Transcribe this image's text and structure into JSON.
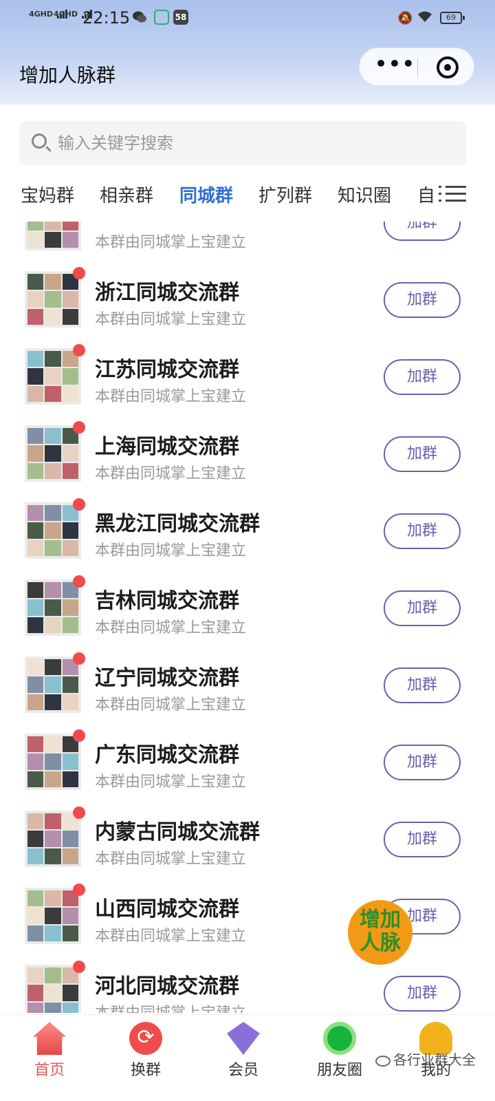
{
  "status_bar": {
    "signal1": "4GHD",
    "signal2": "4GHD",
    "time": "22:15",
    "badge_58": "58",
    "battery": "69"
  },
  "header": {
    "title": "增加人脉群",
    "more_label": "•••"
  },
  "search": {
    "placeholder": "输入关键字搜索"
  },
  "tabs": [
    {
      "label": "宝妈群"
    },
    {
      "label": "相亲群"
    },
    {
      "label": "同城群"
    },
    {
      "label": "扩列群"
    },
    {
      "label": "知识圈"
    },
    {
      "label": "自"
    }
  ],
  "active_tab": "同城群",
  "groups": [
    {
      "name": "",
      "subtitle": "本群由同城掌上宝建立",
      "button": "加群"
    },
    {
      "name": "浙江同城交流群",
      "subtitle": "本群由同城掌上宝建立",
      "button": "加群"
    },
    {
      "name": "江苏同城交流群",
      "subtitle": "本群由同城掌上宝建立",
      "button": "加群"
    },
    {
      "name": "上海同城交流群",
      "subtitle": "本群由同城掌上宝建立",
      "button": "加群"
    },
    {
      "name": "黑龙江同城交流群",
      "subtitle": "本群由同城掌上宝建立",
      "button": "加群"
    },
    {
      "name": "吉林同城交流群",
      "subtitle": "本群由同城掌上宝建立",
      "button": "加群"
    },
    {
      "name": "辽宁同城交流群",
      "subtitle": "本群由同城掌上宝建立",
      "button": "加群"
    },
    {
      "name": "广东同城交流群",
      "subtitle": "本群由同城掌上宝建立",
      "button": "加群"
    },
    {
      "name": "内蒙古同城交流群",
      "subtitle": "本群由同城掌上宝建立",
      "button": "加群"
    },
    {
      "name": "山西同城交流群",
      "subtitle": "本群由同城掌上宝建立",
      "button": "加群"
    },
    {
      "name": "河北同城交流群",
      "subtitle": "本群由同城掌上宝建立",
      "button": "加群"
    }
  ],
  "floating_button": {
    "line1": "增加",
    "line2": "人脉"
  },
  "bottom_nav": [
    {
      "label": "首页",
      "icon": "home-icon"
    },
    {
      "label": "换群",
      "icon": "swap-icon"
    },
    {
      "label": "会员",
      "icon": "vip-icon"
    },
    {
      "label": "朋友圈",
      "icon": "moments-icon"
    },
    {
      "label": "我的",
      "icon": "profile-icon"
    }
  ],
  "watermark": "各行业群大全",
  "colors": {
    "accent_tab": "#2f6fd6",
    "join_button": "#6a5fb0",
    "unread_dot": "#f24a4a",
    "nav_active": "#e45757"
  }
}
